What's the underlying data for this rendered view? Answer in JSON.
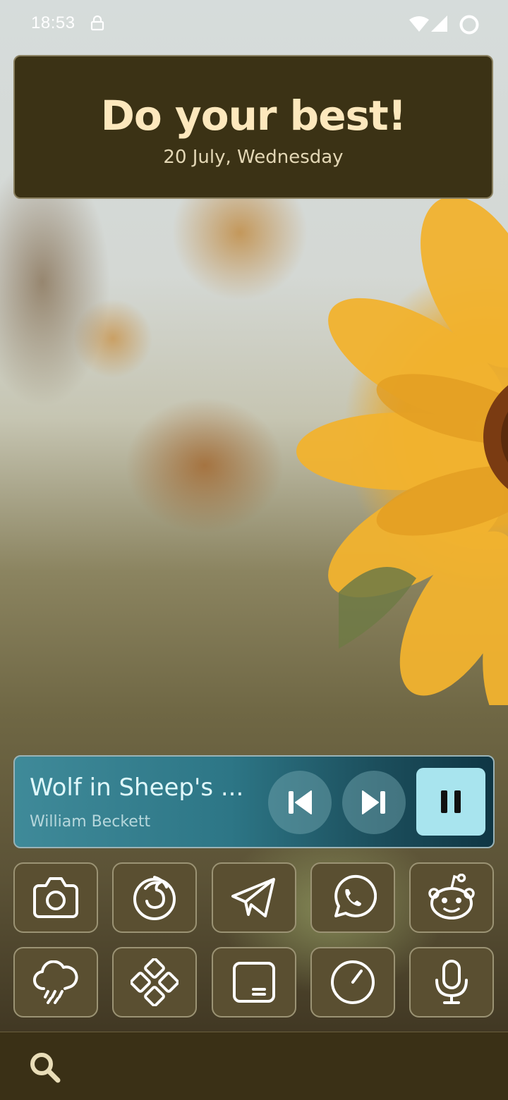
{
  "status_bar": {
    "time": "18:53",
    "icons": [
      "lock-icon",
      "wifi-icon",
      "signal-icon",
      "battery-icon"
    ]
  },
  "quote_widget": {
    "title": "Do your best!",
    "date": "20 July, Wednesday"
  },
  "media_player": {
    "track_title": "Wolf in Sheep's ...",
    "artist": "William Beckett",
    "controls": [
      "previous-track",
      "next-track",
      "pause"
    ]
  },
  "app_grid": {
    "row1": [
      "camera-icon",
      "firefox-icon",
      "telegram-icon",
      "whatsapp-icon",
      "reddit-icon"
    ],
    "row2": [
      "weather-icon",
      "apps-icon",
      "notes-icon",
      "clock-icon",
      "recorder-icon"
    ]
  },
  "bottom_bar": {
    "icon": "search-icon"
  },
  "colors": {
    "card_bg": "#3b3215",
    "quote_title": "#fde8bd",
    "media_accent": "#a8e4ee",
    "tile_bg": "#5a4f31"
  }
}
